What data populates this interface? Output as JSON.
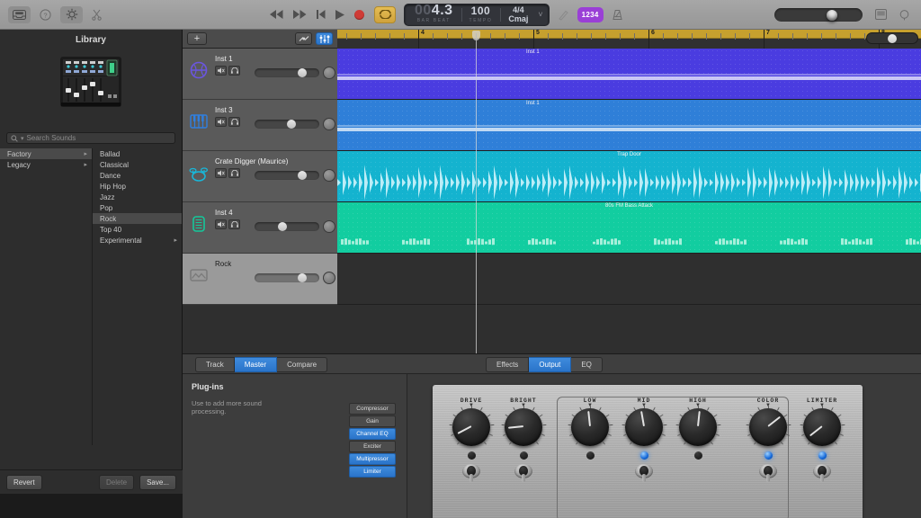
{
  "toolbar": {
    "left_icons": [
      {
        "name": "library-toggle-icon",
        "glyph": "library"
      },
      {
        "name": "help-icon",
        "glyph": "question"
      },
      {
        "name": "smart-controls-icon",
        "glyph": "gear"
      },
      {
        "name": "scissors-icon",
        "glyph": "scissors"
      }
    ],
    "transport": {
      "rewind_label": "Rewind",
      "forward_label": "Fast Forward",
      "go_to_beginning_label": "Go to Beginning",
      "play_label": "Play",
      "record_label": "Record",
      "cycle_label": "Cycle"
    },
    "lcd": {
      "position_dim": "00",
      "position": "4.3",
      "position_sub": "BAR        BEAT",
      "tempo": "100",
      "tempo_sub": "TEMPO",
      "time_signature": "4/4",
      "key_signature": "Cmaj",
      "caret": "˅"
    },
    "count_in_badge": "1234",
    "metronome_label": "Metronome",
    "tuner_label": "Tuner",
    "master_volume_label": "Master Volume",
    "right_icons": [
      {
        "name": "note-pad-icon",
        "glyph": "notepad"
      },
      {
        "name": "loop-browser-icon",
        "glyph": "loop"
      }
    ]
  },
  "library": {
    "title": "Library",
    "artwork_name": "mixer-artwork",
    "search": {
      "placeholder": "Search Sounds"
    },
    "left_column": [
      {
        "label": "Factory",
        "selected": true,
        "has_children": true
      },
      {
        "label": "Legacy",
        "selected": false,
        "has_children": true
      }
    ],
    "right_column": [
      {
        "label": "Ballad",
        "selected": false,
        "has_children": false
      },
      {
        "label": "Classical",
        "selected": false,
        "has_children": false
      },
      {
        "label": "Dance",
        "selected": false,
        "has_children": false
      },
      {
        "label": "Hip Hop",
        "selected": false,
        "has_children": false
      },
      {
        "label": "Jazz",
        "selected": false,
        "has_children": false
      },
      {
        "label": "Pop",
        "selected": false,
        "has_children": false
      },
      {
        "label": "Rock",
        "selected": true,
        "has_children": false
      },
      {
        "label": "Top 40",
        "selected": false,
        "has_children": false
      },
      {
        "label": "Experimental",
        "selected": false,
        "has_children": true
      }
    ],
    "footer": {
      "revert": "Revert",
      "delete": "Delete",
      "save": "Save..."
    }
  },
  "arrange": {
    "add_track_label": "+",
    "header_buttons": [
      {
        "name": "automation-button",
        "active": false
      },
      {
        "name": "track-controls-button",
        "active": true
      }
    ],
    "ruler": {
      "bars": [
        "4",
        "5",
        "6",
        "7",
        "8"
      ],
      "cycle_color": "#c6a02e"
    },
    "zoom_slider_label": "Zoom",
    "playhead_position": "4.3",
    "tracks": [
      {
        "name": "Inst 1",
        "icon": "synth-pad-icon",
        "icon_color": "#6b56e0",
        "selected": false,
        "volume": 0.78,
        "region": {
          "label": "Inst 1",
          "color": "#4a3ce0",
          "type": "midi"
        }
      },
      {
        "name": "Inst 3",
        "icon": "piano-icon",
        "icon_color": "#2f7fe0",
        "selected": false,
        "volume": 0.58,
        "region": {
          "label": "Inst 1",
          "color": "#2f7fd8",
          "type": "midi"
        }
      },
      {
        "name": "Crate Digger (Maurice)",
        "icon": "drum-kit-icon",
        "icon_color": "#19b6d8",
        "selected": false,
        "volume": 0.78,
        "region": {
          "label": "Trap Door",
          "color": "#14b3cf",
          "type": "audio"
        }
      },
      {
        "name": "Inst 4",
        "icon": "bass-icon",
        "icon_color": "#14c79a",
        "selected": false,
        "volume": 0.42,
        "region": {
          "label": "80s FM Bass Attack",
          "color": "#12cda0",
          "type": "audio"
        }
      },
      {
        "name": "Rock",
        "icon": "drum-machine-icon",
        "icon_color": "#7a7a7a",
        "selected": true,
        "volume": 0.78,
        "region": null
      }
    ],
    "track_buttons": {
      "mute": "M",
      "headphones": "H"
    }
  },
  "editor": {
    "left_tabs": [
      {
        "label": "Track",
        "selected": false
      },
      {
        "label": "Master",
        "selected": true
      },
      {
        "label": "Compare",
        "selected": false
      }
    ],
    "right_tabs": [
      {
        "label": "Effects",
        "selected": false
      },
      {
        "label": "Output",
        "selected": true
      },
      {
        "label": "EQ",
        "selected": false
      }
    ],
    "plugins_panel": {
      "title": "Plug-ins",
      "description": "Use to add more sound processing.",
      "items": [
        {
          "label": "Compressor",
          "active": false
        },
        {
          "label": "Gain",
          "active": false
        },
        {
          "label": "Channel EQ",
          "active": true
        },
        {
          "label": "Exciter",
          "active": false
        },
        {
          "label": "Multipressor",
          "active": true
        },
        {
          "label": "Limiter",
          "active": true
        }
      ]
    },
    "amp": {
      "groups": [
        {
          "name": "drive-group",
          "knobs": [
            {
              "label": "DRIVE",
              "angle": -118,
              "led_on": false,
              "has_toggle": true
            },
            {
              "label": "BRIGHT",
              "angle": -96,
              "led_on": false,
              "has_toggle": true
            }
          ]
        },
        {
          "name": "eq-group",
          "boxed": true,
          "knobs": [
            {
              "label": "LOW",
              "angle": -6,
              "led_on": false,
              "has_toggle": false
            },
            {
              "label": "MID",
              "angle": -10,
              "led_on": true,
              "has_toggle": true
            },
            {
              "label": "HIGH",
              "angle": 6,
              "led_on": false,
              "has_toggle": false
            }
          ]
        },
        {
          "name": "output-group",
          "knobs": [
            {
              "label": "COLOR",
              "angle": 52,
              "led_on": true,
              "has_toggle": true
            },
            {
              "label": "LIMITER",
              "angle": -128,
              "led_on": true,
              "has_toggle": true
            }
          ]
        }
      ]
    }
  }
}
